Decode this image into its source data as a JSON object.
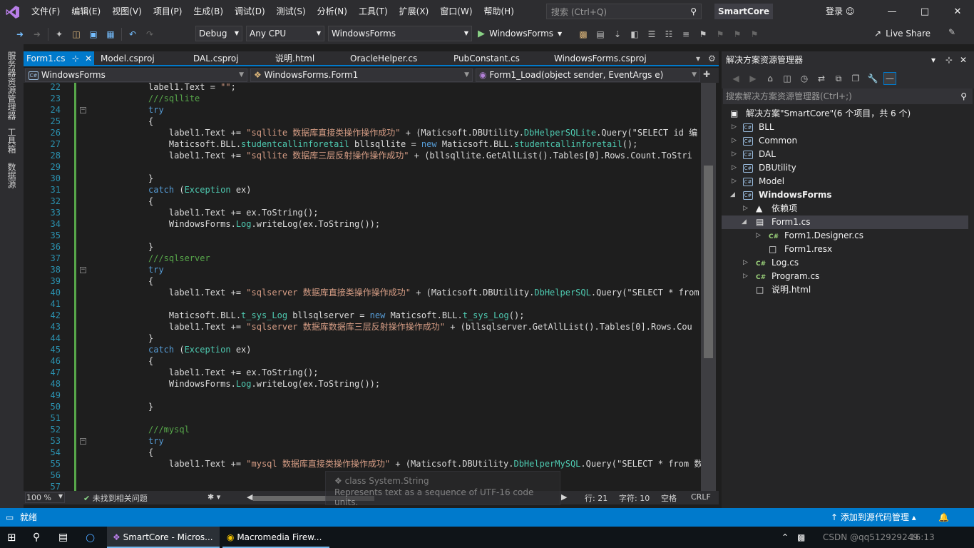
{
  "menu": [
    "文件(F)",
    "编辑(E)",
    "视图(V)",
    "项目(P)",
    "生成(B)",
    "调试(D)",
    "测试(S)",
    "分析(N)",
    "工具(T)",
    "扩展(X)",
    "窗口(W)",
    "帮助(H)"
  ],
  "search": {
    "placeholder": "搜索 (Ctrl+Q)"
  },
  "solution_name": "SmartCore",
  "login": "登录",
  "toolbar": {
    "config": "Debug",
    "platform": "Any CPU",
    "startup": "WindowsForms",
    "run_label": "WindowsForms",
    "liveshare": "Live Share"
  },
  "left_tabs": [
    "服务器资源管理器",
    "工具箱",
    "数据源"
  ],
  "tabs": [
    "Form1.cs",
    "Model.csproj",
    "DAL.csproj",
    "说明.html",
    "OracleHelper.cs",
    "PubConstant.cs",
    "WindowsForms.csproj"
  ],
  "nav": {
    "project": "WindowsForms",
    "class": "WindowsForms.Form1",
    "member": "Form1_Load(object sender, EventArgs e)"
  },
  "code_lines": [
    {
      "n": "22",
      "t": "label1.Text = \"\";"
    },
    {
      "n": "23",
      "t": "///sqllite"
    },
    {
      "n": "24",
      "t": "try"
    },
    {
      "n": "25",
      "t": "{"
    },
    {
      "n": "26",
      "t": "    label1.Text += \"sqllite 数据库直接类操作操作成功\" + (Maticsoft.DBUtility.DbHelperSQLite.Query(\"SELECT id 编"
    },
    {
      "n": "27",
      "t": "    Maticsoft.BLL.studentcallinforetail bllsqllite = new Maticsoft.BLL.studentcallinforetail();"
    },
    {
      "n": "28",
      "t": "    label1.Text += \"sqllite 数据库三层反射操作操作成功\" + (bllsqllite.GetAllList().Tables[0].Rows.Count.ToStri"
    },
    {
      "n": "29",
      "t": ""
    },
    {
      "n": "30",
      "t": "}"
    },
    {
      "n": "31",
      "t": "catch (Exception ex)"
    },
    {
      "n": "32",
      "t": "{"
    },
    {
      "n": "33",
      "t": "    label1.Text += ex.ToString();"
    },
    {
      "n": "34",
      "t": "    WindowsForms.Log.writeLog(ex.ToString());"
    },
    {
      "n": "35",
      "t": ""
    },
    {
      "n": "36",
      "t": "}"
    },
    {
      "n": "37",
      "t": "///sqlserver"
    },
    {
      "n": "38",
      "t": "try"
    },
    {
      "n": "39",
      "t": "{"
    },
    {
      "n": "40",
      "t": "    label1.Text += \"sqlserver 数据库直接类操作操作成功\" + (Maticsoft.DBUtility.DbHelperSQL.Query(\"SELECT * from"
    },
    {
      "n": "41",
      "t": ""
    },
    {
      "n": "42",
      "t": "    Maticsoft.BLL.t_sys_Log bllsqlserver = new Maticsoft.BLL.t_sys_Log();"
    },
    {
      "n": "43",
      "t": "    label1.Text += \"sqlserver 数据库数据库三层反射操作操作成功\" + (bllsqlserver.GetAllList().Tables[0].Rows.Cou"
    },
    {
      "n": "44",
      "t": "}"
    },
    {
      "n": "45",
      "t": "catch (Exception ex)"
    },
    {
      "n": "46",
      "t": "{"
    },
    {
      "n": "47",
      "t": "    label1.Text += ex.ToString();"
    },
    {
      "n": "48",
      "t": "    WindowsForms.Log.writeLog(ex.ToString());"
    },
    {
      "n": "49",
      "t": ""
    },
    {
      "n": "50",
      "t": "}"
    },
    {
      "n": "51",
      "t": ""
    },
    {
      "n": "52",
      "t": "///mysql"
    },
    {
      "n": "53",
      "t": "try"
    },
    {
      "n": "54",
      "t": "{"
    },
    {
      "n": "55",
      "t": "    label1.Text += \"mysql 数据库直接类操作操作成功\" + (Maticsoft.DBUtility.DbHelperMySQL.Query(\"SELECT * from 数"
    },
    {
      "n": "56",
      "t": ""
    },
    {
      "n": "57",
      "t": ""
    }
  ],
  "editor_status": {
    "zoom": "100 %",
    "issues": "未找到相关问题",
    "line": "行: 21",
    "col": "字符: 10",
    "ws": "空格",
    "eol": "CRLF"
  },
  "tooltip": {
    "line1": "class System.String",
    "line2": "Represents text as a sequence of UTF-16 code units."
  },
  "solution_explorer": {
    "title": "解决方案资源管理器",
    "search_placeholder": "搜索解决方案资源管理器(Ctrl+;)",
    "root": "解决方案\"SmartCore\"(6 个项目，共 6 个)",
    "items": [
      {
        "label": "BLL",
        "type": "cs"
      },
      {
        "label": "Common",
        "type": "cs"
      },
      {
        "label": "DAL",
        "type": "cs"
      },
      {
        "label": "DBUtility",
        "type": "cs"
      },
      {
        "label": "Model",
        "type": "cs"
      },
      {
        "label": "WindowsForms",
        "type": "cs"
      },
      {
        "label": "依赖项",
        "type": "dep"
      },
      {
        "label": "Form1.cs",
        "type": "form"
      },
      {
        "label": "Form1.Designer.cs",
        "type": "c#"
      },
      {
        "label": "Form1.resx",
        "type": "file"
      },
      {
        "label": "Log.cs",
        "type": "c#"
      },
      {
        "label": "Program.cs",
        "type": "c#"
      },
      {
        "label": "说明.html",
        "type": "file"
      }
    ]
  },
  "statusbar": {
    "ready": "就绪",
    "source_control": "添加到源代码管理"
  },
  "taskbar": {
    "app1": "SmartCore - Micros...",
    "app2": "Macromedia Firew...",
    "time": "16:13",
    "watermark": "CSDN @qq512929249"
  }
}
